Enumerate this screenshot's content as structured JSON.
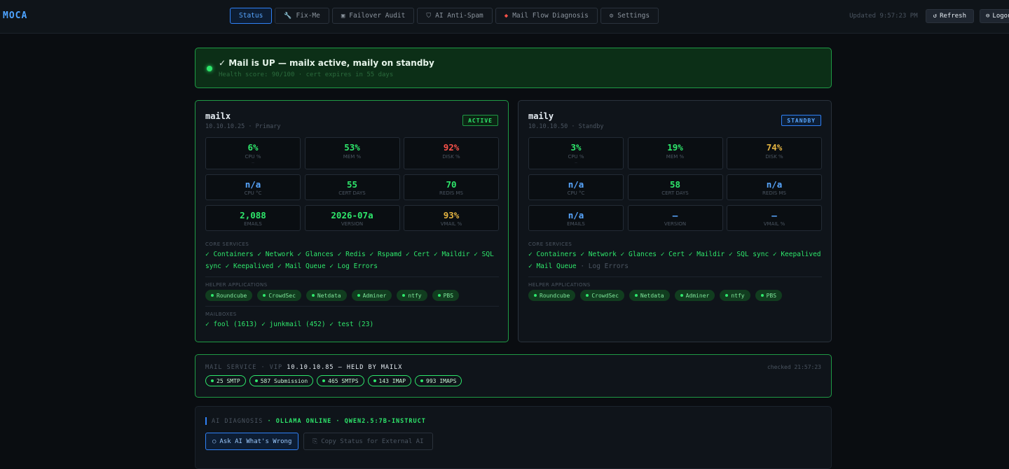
{
  "app": {
    "brand": "MOCA"
  },
  "nav": {
    "tabs": [
      {
        "label": "Status",
        "icon": ""
      },
      {
        "label": "Fix-Me",
        "icon": "🔧"
      },
      {
        "label": "Failover Audit",
        "icon": "▣"
      },
      {
        "label": "AI Anti-Spam",
        "icon": "⛉"
      },
      {
        "label": "Mail Flow Diagnosis",
        "icon": "◆"
      },
      {
        "label": "Settings",
        "icon": "⚙"
      }
    ]
  },
  "header": {
    "updated": "Updated 9:57:23 PM",
    "refresh_icon": "↺",
    "refresh_label": "Refresh",
    "logout_icon": "⊖",
    "logout_label": "Logout"
  },
  "banner": {
    "title": "✓ Mail is UP — mailx active, maily on standby",
    "subtitle": "Health score: 90/100 · cert expires in 55 days"
  },
  "servers": [
    {
      "name": "mailx",
      "ip": "10.10.10.25 · Primary",
      "badge": "ACTIVE",
      "metrics": [
        {
          "value": "6%",
          "label": "CPU %",
          "sub": "—",
          "color": "#2ee66b"
        },
        {
          "value": "53%",
          "label": "MEM %",
          "sub": "",
          "color": "#2ee66b"
        },
        {
          "value": "92%",
          "label": "DISK %",
          "sub": "",
          "color": "#f85149"
        },
        {
          "value": "n/a",
          "label": "CPU °C",
          "sub": "",
          "color": "#58a6ff"
        },
        {
          "value": "55",
          "label": "CERT DAYS",
          "sub": "",
          "color": "#2ee66b"
        },
        {
          "value": "70",
          "label": "REDIS MS",
          "sub": "",
          "color": "#2ee66b"
        },
        {
          "value": "2,088",
          "label": "EMAILS",
          "sub": "",
          "color": "#2ee66b"
        },
        {
          "value": "2026-07a",
          "label": "VERSION",
          "sub": "",
          "color": "#2ee66b"
        },
        {
          "value": "93%",
          "label": "VMAIL %",
          "sub": "",
          "color": "#e3b341"
        }
      ],
      "core_label": "CORE SERVICES",
      "core_services": "✓ Containers ✓ Network ✓ Glances ✓ Redis ✓ Rspamd ✓ Cert ✓ Maildir ✓ SQL sync ✓ Keepalived ✓ Mail Queue ✓ Log Errors",
      "core_muted": "",
      "helper_label": "HELPER APPLICATIONS",
      "helpers": [
        "Roundcube",
        "CrowdSec",
        "Netdata",
        "Adminer",
        "ntfy",
        "PBS"
      ],
      "mailbox_label": "MAILBOXES",
      "mailboxes": "✓ fool (1613) ✓ junkmail (452) ✓ test (23)"
    },
    {
      "name": "maily",
      "ip": "10.10.10.50 · Standby",
      "badge": "STANDBY",
      "metrics": [
        {
          "value": "3%",
          "label": "CPU %",
          "sub": "—",
          "color": "#2ee66b"
        },
        {
          "value": "19%",
          "label": "MEM %",
          "sub": "",
          "color": "#2ee66b"
        },
        {
          "value": "74%",
          "label": "DISK %",
          "sub": "",
          "color": "#e3b341"
        },
        {
          "value": "n/a",
          "label": "CPU °C",
          "sub": "",
          "color": "#58a6ff"
        },
        {
          "value": "58",
          "label": "CERT DAYS",
          "sub": "",
          "color": "#2ee66b"
        },
        {
          "value": "n/a",
          "label": "REDIS MS",
          "sub": "",
          "color": "#58a6ff"
        },
        {
          "value": "n/a",
          "label": "EMAILS",
          "sub": "",
          "color": "#58a6ff"
        },
        {
          "value": "—",
          "label": "VERSION",
          "sub": "",
          "color": "#58a6ff"
        },
        {
          "value": "—",
          "label": "VMAIL %",
          "sub": "",
          "color": "#58a6ff"
        }
      ],
      "core_label": "CORE SERVICES",
      "core_services": "✓ Containers ✓ Network ✓ Glances ✓ Cert ✓ Maildir ✓ SQL sync ✓ Keepalived ✓ Mail Queue",
      "core_muted": " · Log Errors",
      "helper_label": "HELPER APPLICATIONS",
      "helpers": [
        "Roundcube",
        "CrowdSec",
        "Netdata",
        "Adminer",
        "ntfy",
        "PBS"
      ]
    }
  ],
  "mail_service": {
    "prefix": "MAIL SERVICE · VIP ",
    "vip": "10.10.10.85 — HELD BY MAILX",
    "checked": "checked 21:57:23",
    "ports": [
      "25 SMTP",
      "587 Submission",
      "465 SMTPS",
      "143 IMAP",
      "993 IMAPS"
    ]
  },
  "ai_diagnosis": {
    "title": "AI DIAGNOSIS",
    "status": " · OLLAMA ONLINE · QWEN2.5:7B-INSTRUCT",
    "ask_icon": "○",
    "ask_label": "Ask AI What's Wrong",
    "copy_icon": "⎘",
    "copy_label": "Copy Status for External AI"
  },
  "colors": {
    "accent": "#2f81f7",
    "ok": "#2ee66b",
    "warn": "#e3b341",
    "crit": "#f85149"
  }
}
